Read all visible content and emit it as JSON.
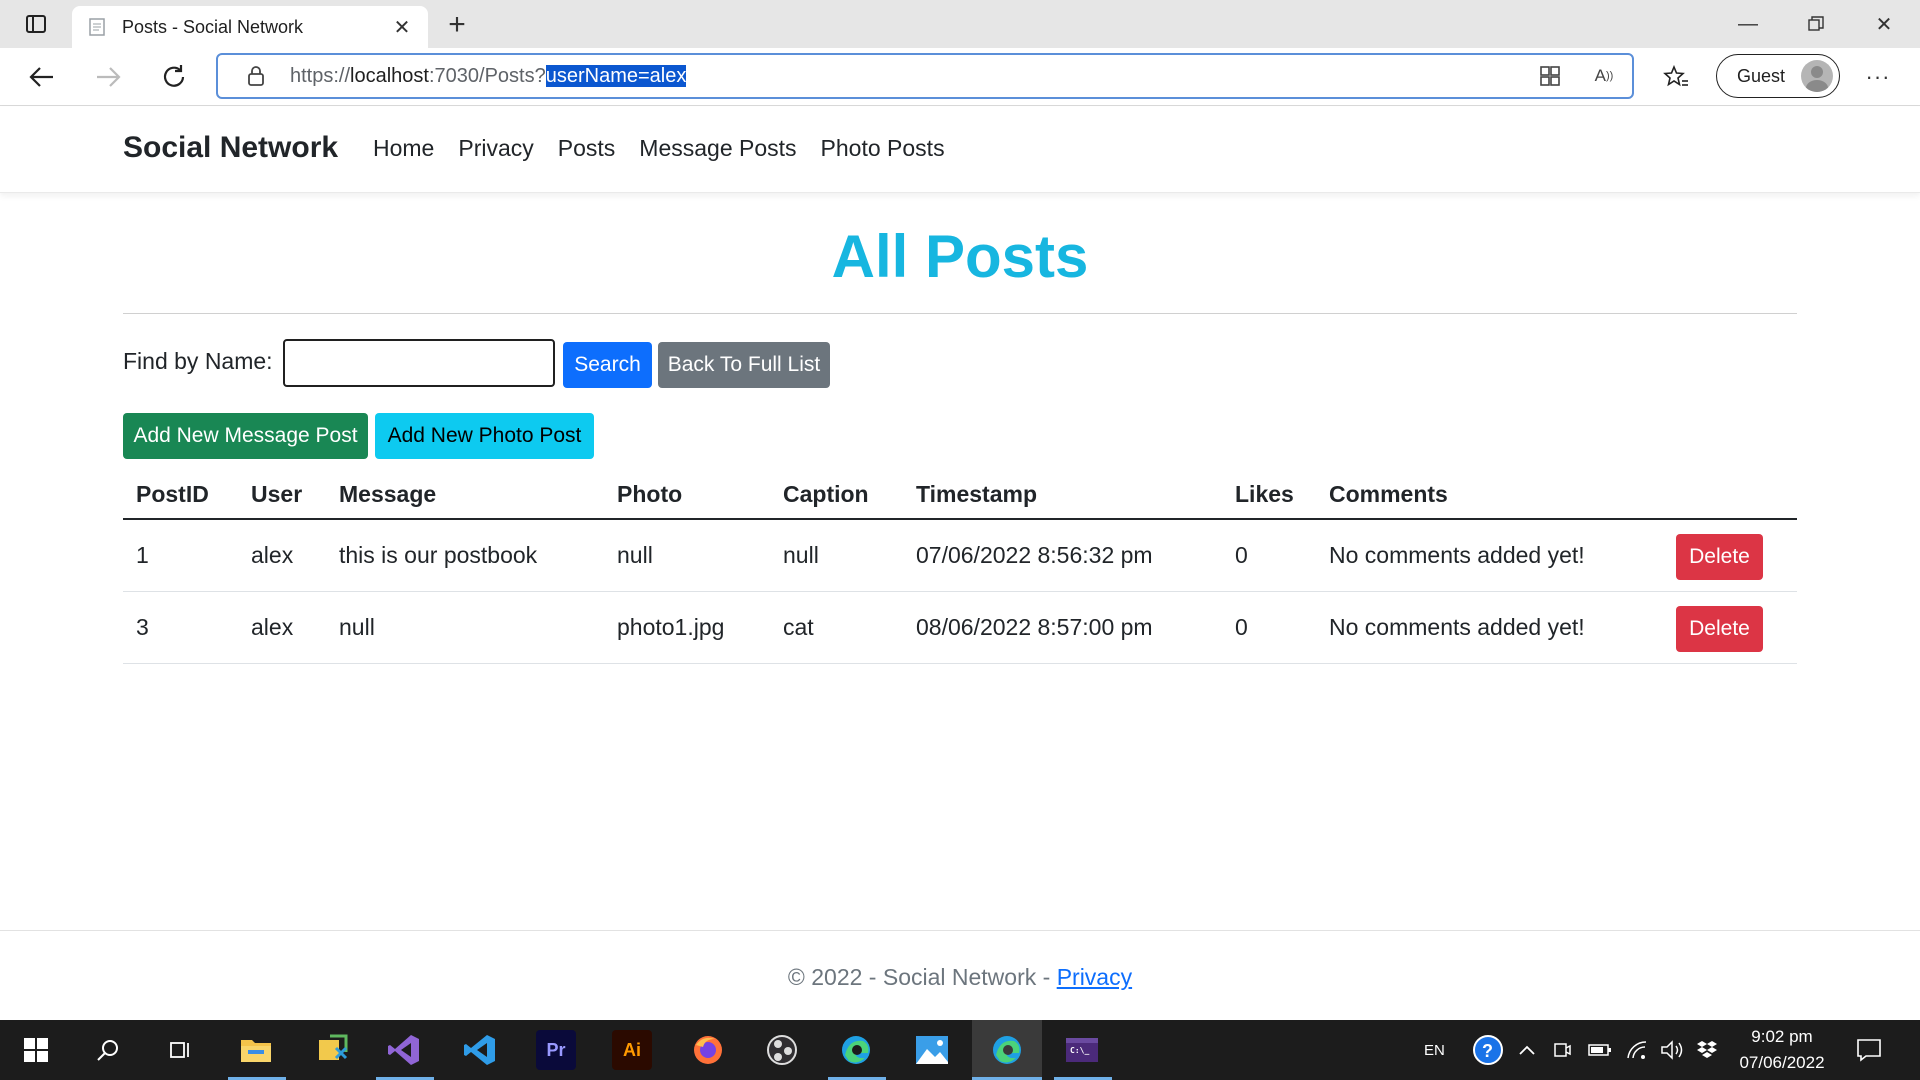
{
  "browser": {
    "tab_title": "Posts - Social Network",
    "url_base": "https://",
    "url_host": "localhost",
    "url_path": ":7030/Posts?",
    "url_selected": "userName=alex",
    "guest_label": "Guest"
  },
  "site": {
    "brand": "Social Network",
    "nav": [
      "Home",
      "Privacy",
      "Posts",
      "Message Posts",
      "Photo Posts"
    ]
  },
  "page": {
    "heading": "All Posts",
    "find_label": "Find by Name:",
    "search_value": "",
    "search_button": "Search",
    "back_button": "Back To Full List",
    "add_message_button": "Add New Message Post",
    "add_photo_button": "Add New Photo Post"
  },
  "table": {
    "headers": [
      "PostID",
      "User",
      "Message",
      "Photo",
      "Caption",
      "Timestamp",
      "Likes",
      "Comments"
    ],
    "rows": [
      {
        "postid": "1",
        "user": "alex",
        "message": "this is our postbook",
        "photo": "null",
        "caption": "null",
        "timestamp": "07/06/2022 8:56:32 pm",
        "likes": "0",
        "comments": "No comments added yet!",
        "action": "Delete"
      },
      {
        "postid": "3",
        "user": "alex",
        "message": "null",
        "photo": "photo1.jpg",
        "caption": "cat",
        "timestamp": "08/06/2022 8:57:00 pm",
        "likes": "0",
        "comments": "No comments added yet!",
        "action": "Delete"
      }
    ]
  },
  "footer": {
    "text": "© 2022 - Social Network - ",
    "link": "Privacy"
  },
  "taskbar": {
    "lang": "EN",
    "time": "9:02 pm",
    "date": "07/06/2022"
  },
  "colors": {
    "heading": "#17b6e0",
    "primary": "#0d6efd",
    "secondary": "#6c757d",
    "success": "#198754",
    "info": "#0dcaf0",
    "danger": "#dc3545"
  }
}
